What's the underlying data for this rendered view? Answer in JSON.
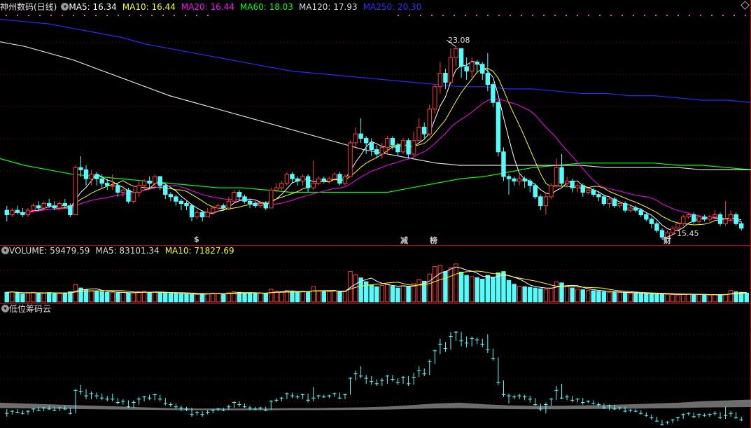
{
  "header": {
    "title": "神州数码(日线)",
    "ma_items": [
      {
        "label": "MA5: 16.34",
        "color": "#ffffff"
      },
      {
        "label": "MA10: 16.44",
        "color": "#ffff00"
      },
      {
        "label": "MA20: 16.44",
        "color": "#ff00ff"
      },
      {
        "label": "MA60: 18.03",
        "color": "#00ff00"
      },
      {
        "label": "MA120: 17.93",
        "color": "#dcdcdc"
      },
      {
        "label": "MA250: 20.30",
        "color": "#3030ff"
      }
    ]
  },
  "volume_header": {
    "items": [
      {
        "label": "VOLUME: 59479.59",
        "color": "#dcdcdc"
      },
      {
        "label": "MA5: 83101.34",
        "color": "#dcdcdc"
      },
      {
        "label": "MA10: 71827.69",
        "color": "#ffff00"
      }
    ]
  },
  "chip_header": {
    "title": "低位筹码云"
  },
  "annotations": {
    "high": "23.08",
    "low": "15.45"
  },
  "markers": [
    {
      "text": "$",
      "color": "#ff3030"
    },
    {
      "text": "减",
      "color": "#00dd00"
    },
    {
      "text": "榜",
      "color": "#ff9900"
    },
    {
      "text": "财",
      "color": "#66aaff"
    }
  ],
  "colors": {
    "up": "#ff3b3b",
    "down": "#54fcfc",
    "grid": "#8b0000",
    "chip": "#808080"
  },
  "chart_data": {
    "type": "candlestick",
    "title": "神州数码(日线)",
    "ylim": [
      14.4,
      24.6
    ],
    "candles": [
      [
        15.8,
        15.6,
        16.0,
        15.3
      ],
      [
        15.6,
        15.8,
        15.9,
        15.5
      ],
      [
        15.8,
        15.7,
        16.0,
        15.6
      ],
      [
        15.7,
        15.6,
        15.9,
        15.5
      ],
      [
        15.6,
        15.8,
        15.9,
        15.5
      ],
      [
        15.8,
        16.0,
        16.1,
        15.7
      ],
      [
        16.0,
        15.9,
        16.2,
        15.8
      ],
      [
        15.9,
        16.1,
        16.2,
        15.8
      ],
      [
        16.1,
        16.0,
        16.3,
        15.9
      ],
      [
        16.0,
        15.9,
        16.2,
        15.8
      ],
      [
        15.9,
        16.1,
        16.2,
        15.8
      ],
      [
        16.1,
        16.0,
        16.3,
        15.9
      ],
      [
        16.0,
        15.6,
        16.1,
        15.5
      ],
      [
        15.6,
        17.7,
        17.8,
        15.6
      ],
      [
        17.7,
        17.6,
        18.2,
        17.3
      ],
      [
        17.6,
        17.2,
        17.8,
        16.9
      ],
      [
        17.2,
        17.4,
        17.6,
        16.9
      ],
      [
        17.4,
        17.2,
        17.5,
        16.9
      ],
      [
        17.2,
        17.0,
        17.4,
        16.8
      ],
      [
        17.0,
        16.9,
        17.2,
        16.7
      ],
      [
        16.9,
        16.9,
        17.4,
        16.7
      ],
      [
        16.9,
        16.6,
        17.0,
        16.4
      ],
      [
        16.6,
        16.7,
        16.9,
        16.4
      ],
      [
        16.7,
        16.2,
        16.8,
        16.1
      ],
      [
        16.2,
        16.6,
        16.8,
        16.1
      ],
      [
        16.6,
        16.9,
        17.1,
        16.4
      ],
      [
        16.9,
        17.1,
        17.2,
        16.7
      ],
      [
        17.1,
        17.0,
        17.3,
        16.8
      ],
      [
        17.0,
        17.3,
        17.4,
        16.8
      ],
      [
        17.3,
        16.9,
        17.3,
        16.7
      ],
      [
        16.9,
        16.5,
        17.0,
        16.3
      ],
      [
        16.5,
        16.4,
        16.6,
        16.2
      ],
      [
        16.4,
        16.2,
        16.5,
        16.0
      ],
      [
        16.2,
        16.1,
        16.3,
        15.8
      ],
      [
        16.1,
        16.0,
        16.2,
        15.8
      ],
      [
        16.0,
        15.5,
        16.1,
        15.3
      ],
      [
        15.5,
        15.7,
        15.8,
        15.4
      ],
      [
        15.7,
        15.5,
        15.8,
        15.3
      ],
      [
        15.5,
        15.7,
        15.9,
        15.5
      ],
      [
        15.7,
        15.9,
        16.0,
        15.6
      ],
      [
        15.9,
        16.0,
        16.1,
        15.8
      ],
      [
        16.0,
        15.9,
        16.1,
        15.8
      ],
      [
        15.9,
        16.2,
        16.4,
        15.9
      ],
      [
        16.2,
        16.6,
        16.7,
        16.1
      ],
      [
        16.6,
        16.4,
        16.7,
        16.2
      ],
      [
        16.4,
        16.2,
        16.5,
        16.1
      ],
      [
        16.2,
        16.1,
        16.3,
        15.9
      ],
      [
        16.1,
        16.0,
        16.2,
        15.9
      ],
      [
        16.0,
        16.1,
        16.2,
        15.9
      ],
      [
        16.1,
        15.9,
        16.2,
        15.8
      ],
      [
        15.9,
        16.7,
        16.8,
        15.9
      ],
      [
        16.7,
        16.8,
        17.0,
        16.6
      ],
      [
        16.8,
        17.0,
        17.1,
        16.7
      ],
      [
        17.0,
        17.4,
        17.5,
        16.9
      ],
      [
        17.4,
        17.2,
        17.5,
        17.0
      ],
      [
        17.2,
        17.1,
        17.3,
        16.9
      ],
      [
        17.1,
        17.3,
        17.4,
        16.9
      ],
      [
        17.3,
        16.8,
        17.4,
        16.6
      ],
      [
        16.8,
        17.0,
        18.0,
        16.7
      ],
      [
        17.0,
        17.2,
        17.3,
        16.9
      ],
      [
        17.2,
        17.1,
        17.3,
        17.0
      ],
      [
        17.1,
        17.2,
        17.3,
        17.0
      ],
      [
        17.2,
        17.4,
        17.5,
        17.1
      ],
      [
        17.4,
        17.0,
        17.5,
        16.9
      ],
      [
        17.0,
        17.3,
        17.4,
        16.9
      ],
      [
        17.3,
        18.8,
        18.9,
        17.3
      ],
      [
        18.8,
        19.2,
        19.5,
        18.6
      ],
      [
        19.2,
        19.0,
        19.9,
        18.8
      ],
      [
        19.0,
        18.8,
        19.1,
        18.3
      ],
      [
        18.8,
        18.5,
        19.0,
        18.2
      ],
      [
        18.5,
        18.3,
        18.7,
        18.1
      ],
      [
        18.3,
        18.6,
        18.8,
        18.1
      ],
      [
        18.6,
        19.0,
        19.1,
        18.3
      ],
      [
        19.0,
        18.7,
        19.1,
        18.5
      ],
      [
        18.7,
        18.4,
        18.8,
        18.2
      ],
      [
        18.4,
        18.9,
        19.0,
        18.3
      ],
      [
        18.9,
        18.3,
        19.0,
        18.1
      ],
      [
        18.3,
        18.9,
        19.3,
        18.2
      ],
      [
        18.9,
        19.5,
        19.9,
        18.9
      ],
      [
        19.5,
        19.2,
        19.7,
        19.0
      ],
      [
        19.2,
        20.3,
        20.5,
        19.1
      ],
      [
        20.3,
        21.3,
        21.4,
        20.1
      ],
      [
        21.3,
        21.9,
        22.4,
        21.0
      ],
      [
        21.9,
        21.5,
        22.1,
        21.2
      ],
      [
        21.5,
        22.6,
        23.0,
        21.4
      ],
      [
        22.6,
        23.0,
        23.08,
        22.2
      ],
      [
        23.0,
        22.2,
        23.0,
        21.7
      ],
      [
        22.2,
        22.0,
        22.6,
        21.6
      ],
      [
        22.0,
        22.4,
        22.6,
        21.7
      ],
      [
        22.4,
        22.3,
        22.5,
        21.9
      ],
      [
        22.3,
        21.9,
        22.4,
        21.6
      ],
      [
        21.9,
        21.4,
        22.8,
        21.1
      ],
      [
        21.4,
        20.6,
        21.5,
        20.4
      ],
      [
        20.6,
        18.4,
        20.7,
        18.2
      ],
      [
        18.4,
        17.3,
        18.6,
        17.1
      ],
      [
        17.3,
        17.2,
        17.4,
        16.5
      ],
      [
        17.2,
        17.1,
        17.3,
        16.9
      ],
      [
        17.1,
        17.2,
        17.4,
        16.9
      ],
      [
        17.2,
        17.1,
        17.3,
        16.8
      ],
      [
        17.1,
        16.9,
        17.2,
        16.6
      ],
      [
        16.9,
        16.4,
        17.0,
        16.3
      ],
      [
        16.4,
        16.0,
        16.5,
        15.8
      ],
      [
        16.0,
        16.4,
        16.6,
        15.6
      ],
      [
        16.4,
        16.9,
        17.0,
        16.3
      ],
      [
        16.9,
        17.7,
        18.1,
        16.8
      ],
      [
        17.7,
        17.0,
        18.3,
        16.9
      ],
      [
        17.0,
        17.1,
        17.3,
        16.8
      ],
      [
        17.1,
        16.8,
        17.2,
        16.6
      ],
      [
        16.8,
        16.9,
        17.0,
        16.6
      ],
      [
        16.9,
        16.6,
        17.0,
        16.4
      ],
      [
        16.6,
        16.7,
        16.8,
        16.5
      ],
      [
        16.7,
        16.5,
        16.8,
        16.4
      ],
      [
        16.5,
        16.4,
        16.6,
        16.2
      ],
      [
        16.4,
        16.1,
        16.5,
        16.0
      ],
      [
        16.1,
        16.3,
        16.4,
        15.9
      ],
      [
        16.3,
        16.0,
        16.4,
        15.9
      ],
      [
        16.0,
        16.1,
        16.2,
        15.9
      ],
      [
        16.1,
        15.8,
        16.2,
        15.7
      ],
      [
        15.8,
        15.9,
        16.0,
        15.7
      ],
      [
        15.9,
        15.8,
        16.0,
        15.7
      ],
      [
        15.8,
        15.6,
        15.9,
        15.5
      ],
      [
        15.6,
        15.4,
        15.7,
        15.3
      ],
      [
        15.4,
        15.2,
        15.5,
        15.0
      ],
      [
        15.2,
        14.9,
        15.3,
        14.8
      ],
      [
        14.9,
        14.6,
        15.0,
        14.5
      ],
      [
        14.6,
        14.8,
        14.9,
        14.6
      ],
      [
        14.8,
        15.0,
        15.1,
        14.7
      ],
      [
        15.0,
        15.2,
        15.3,
        14.9
      ],
      [
        15.2,
        15.5,
        15.6,
        15.1
      ],
      [
        15.5,
        15.6,
        15.7,
        15.4
      ],
      [
        15.6,
        15.3,
        15.7,
        15.2
      ],
      [
        15.3,
        15.5,
        15.6,
        15.2
      ],
      [
        15.5,
        15.4,
        15.6,
        15.3
      ],
      [
        15.4,
        15.5,
        15.6,
        15.3
      ],
      [
        15.5,
        15.6,
        15.8,
        15.4
      ],
      [
        15.6,
        15.2,
        15.7,
        15.1
      ],
      [
        15.2,
        15.4,
        16.2,
        15.1
      ],
      [
        15.4,
        15.6,
        15.8,
        15.3
      ],
      [
        15.6,
        15.2,
        15.7,
        15.1
      ],
      [
        15.2,
        15.0,
        15.3,
        14.9
      ]
    ],
    "ma_lines": [
      {
        "name": "MA5",
        "color": "#ffffff"
      },
      {
        "name": "MA10",
        "color": "#ffff00"
      },
      {
        "name": "MA20",
        "color": "#ff00ff"
      },
      {
        "name": "MA60",
        "color": "#00ff00",
        "start": 18.1,
        "values": [
          18.1,
          17.8,
          17.6,
          17.4,
          17.3,
          17.2,
          17.1,
          17.0,
          16.9,
          16.8,
          16.8,
          16.7,
          16.6,
          16.6,
          16.6,
          16.6,
          16.6,
          16.8,
          17.0,
          17.2,
          17.3,
          17.5,
          17.7,
          17.8,
          17.9,
          17.9,
          17.9,
          17.9,
          17.8,
          17.8,
          17.7,
          17.6
        ]
      },
      {
        "name": "MA120",
        "color": "#dcdcdc",
        "values": [
          23.3,
          23.1,
          22.8,
          22.5,
          22.1,
          21.7,
          21.3,
          20.9,
          20.6,
          20.3,
          20.0,
          19.7,
          19.4,
          19.1,
          18.8,
          18.5,
          18.3,
          18.1,
          17.9,
          17.8,
          17.8,
          17.8,
          17.8,
          17.8,
          17.8,
          17.7,
          17.7,
          17.7,
          17.7,
          17.6,
          17.6,
          17.6
        ]
      },
      {
        "name": "MA250",
        "color": "#2a2aff",
        "values": [
          24.3,
          24.2,
          24.1,
          23.9,
          23.7,
          23.5,
          23.2,
          23.0,
          22.8,
          22.6,
          22.4,
          22.2,
          22.0,
          21.9,
          21.8,
          21.7,
          21.6,
          21.5,
          21.4,
          21.3,
          21.3,
          21.2,
          21.2,
          21.1,
          21.0,
          21.0,
          20.9,
          20.9,
          20.8,
          20.7,
          20.7,
          20.6
        ]
      }
    ],
    "volume": {
      "ylim": [
        0,
        180000
      ],
      "values": [
        38000,
        40000,
        36000,
        32000,
        35000,
        38000,
        36000,
        34000,
        37000,
        35000,
        33000,
        36000,
        40000,
        68000,
        55000,
        48000,
        45000,
        42000,
        40000,
        38000,
        37000,
        36000,
        38000,
        35000,
        36000,
        40000,
        42000,
        38000,
        39000,
        37000,
        36000,
        34000,
        33000,
        31000,
        30000,
        32000,
        30000,
        31000,
        32000,
        35000,
        34000,
        33000,
        36000,
        40000,
        38000,
        36000,
        34000,
        33000,
        35000,
        32000,
        50000,
        42000,
        41000,
        45000,
        40000,
        38000,
        42000,
        40000,
        60000,
        42000,
        40000,
        41000,
        43000,
        40000,
        41000,
        120000,
        108000,
        95000,
        80000,
        68000,
        60000,
        65000,
        70000,
        62000,
        55000,
        64000,
        60000,
        72000,
        88000,
        82000,
        110000,
        140000,
        145000,
        120000,
        135000,
        150000,
        118000,
        105000,
        100000,
        96000,
        90000,
        105000,
        98000,
        115000,
        120000,
        85000,
        70000,
        62000,
        60000,
        58000,
        55000,
        52000,
        50000,
        55000,
        80000,
        75000,
        62000,
        55000,
        50000,
        48000,
        45000,
        44000,
        42000,
        40000,
        38000,
        39000,
        37000,
        36000,
        35000,
        34000,
        33000,
        34000,
        32000,
        31000,
        30000,
        30000,
        29000,
        28000,
        30000,
        31000,
        30000,
        29000,
        28000,
        27000,
        28000,
        29000,
        30000,
        45000,
        40000,
        38000,
        35000
      ]
    },
    "chip": {
      "ylim": [
        0,
        1
      ],
      "cloud": [
        0.22,
        0.2,
        0.18,
        0.16,
        0.14,
        0.12,
        0.1,
        0.08,
        0.07,
        0.07,
        0.07,
        0.07,
        0.08,
        0.08,
        0.09,
        0.1,
        0.12,
        0.16,
        0.2,
        0.22,
        0.18,
        0.15,
        0.14,
        0.14,
        0.15,
        0.16,
        0.18,
        0.2,
        0.22,
        0.26,
        0.28,
        0.3
      ]
    }
  }
}
